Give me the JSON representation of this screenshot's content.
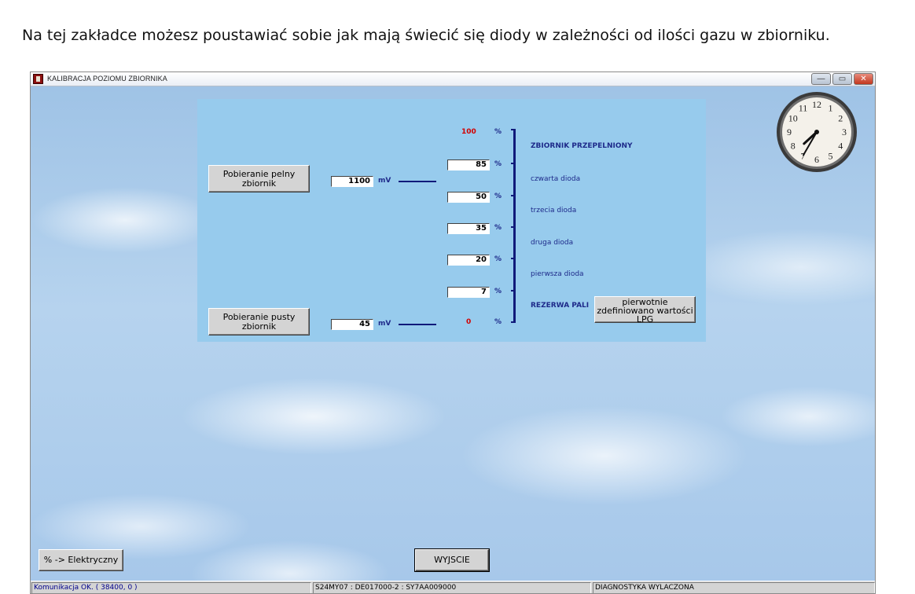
{
  "caption": "Na tej zakładce możesz poustawiać sobie jak mają świecić się diody w zależności od ilości gazu w zbiorniku.",
  "window": {
    "title": "KALIBRACJA POZIOMU ZBIORNIKA",
    "min_glyph": "—",
    "max_glyph": "▭",
    "close_glyph": "✕"
  },
  "calibration": {
    "full_button_label": "Pobieranie pelny zbiornik",
    "empty_button_label": "Pobieranie pusty zbiornik",
    "full_mv_value": "1100",
    "empty_mv_value": "45",
    "mv_unit": "mV",
    "top_percent": "100",
    "bottom_percent": "0",
    "percent_symbol": "%",
    "thresholds": [
      "85",
      "50",
      "35",
      "20",
      "7"
    ],
    "zones": [
      "ZBIORNIK PRZEPELNIONY",
      "czwarta dioda",
      "trzecia dioda",
      "druga dioda",
      "pierwsza dioda",
      "REZERWA PALI"
    ],
    "defaults_button_label": "pierwotnie zdefiniowano wartości LPG"
  },
  "footer": {
    "electric_button_label": "% -> Elektryczny",
    "exit_button_label": "WYJSCIE"
  },
  "status": {
    "connection": "Komunikacja OK. ( 38400,  0 )",
    "device": "S24MY07 : DE017000-2 : SY7AA009000",
    "diagnostics": "DIAGNOSTYKA WYLACZONA"
  },
  "clock": {
    "numerals": [
      "12",
      "1",
      "2",
      "3",
      "4",
      "5",
      "6",
      "7",
      "8",
      "9",
      "10",
      "11"
    ],
    "hour": 7,
    "minute": 35
  },
  "colors": {
    "panel": "#97cbed",
    "label_blue": "#1e2a8a",
    "accent_red": "#d10000",
    "status_text_blue": "#00008b"
  }
}
